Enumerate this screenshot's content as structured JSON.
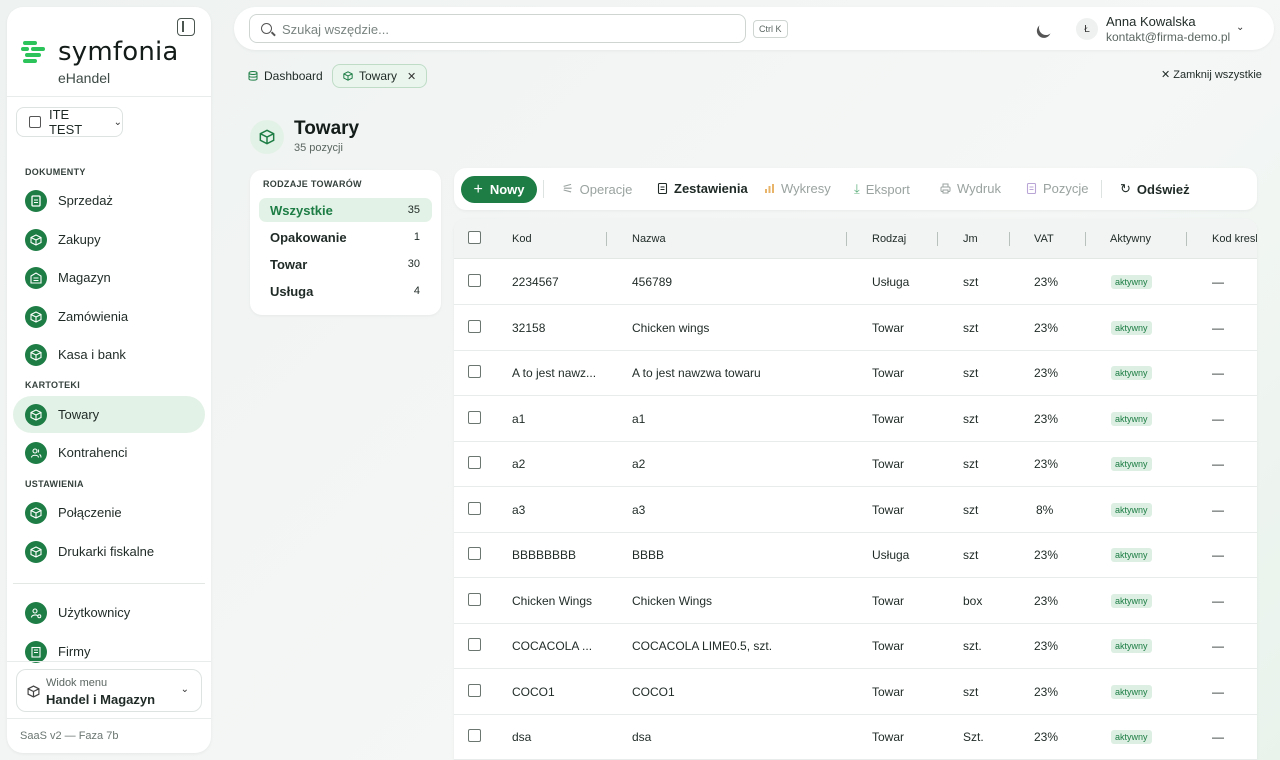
{
  "sidebar": {
    "logo_text": "symfonia",
    "logo_sub": "eHandel",
    "company": "ITE TEST",
    "sections": {
      "dokumenty": "DOKUMENTY",
      "kartoteki": "KARTOTEKI",
      "ustawienia": "USTAWIENIA"
    },
    "items": {
      "sprzedaz": "Sprzedaż",
      "zakupy": "Zakupy",
      "magazyn": "Magazyn",
      "zamowienia": "Zamówienia",
      "kasa": "Kasa i bank",
      "towary": "Towary",
      "kontrahenci": "Kontrahenci",
      "polaczenie": "Połączenie",
      "drukarki": "Drukarki fiskalne",
      "uzytkownicy": "Użytkownicy",
      "firmy": "Firmy"
    },
    "view_menu": {
      "label": "Widok menu",
      "value": "Handel i Magazyn"
    },
    "footer": "SaaS v2 — Faza 7b",
    "accent_color": "#1d7d45"
  },
  "header": {
    "search_placeholder": "Szukaj wszędzie...",
    "shortcut": "Ctrl K",
    "user": {
      "initial": "Ł",
      "name": "Anna Kowalska",
      "email": "kontakt@firma-demo.pl"
    }
  },
  "tabs": {
    "dashboard": "Dashboard",
    "towary": "Towary",
    "close_all": "Zamknij wszystkie"
  },
  "page": {
    "title": "Towary",
    "subtitle": "35 pozycji"
  },
  "categories": {
    "header": "RODZAJE TOWARÓW",
    "items": [
      {
        "label": "Wszystkie",
        "count": "35"
      },
      {
        "label": "Opakowanie",
        "count": "1"
      },
      {
        "label": "Towar",
        "count": "30"
      },
      {
        "label": "Usługa",
        "count": "4"
      }
    ]
  },
  "toolbar": {
    "new": "Nowy",
    "operacje": "Operacje",
    "zestawienia": "Zestawienia",
    "wykresy": "Wykresy",
    "eksport": "Eksport",
    "wydruk": "Wydruk",
    "pozycje": "Pozycje",
    "odswiez": "Odśwież"
  },
  "table": {
    "columns": [
      "Kod",
      "Nazwa",
      "Rodzaj",
      "Jm",
      "VAT",
      "Aktywny",
      "Kod kresk"
    ],
    "rows": [
      [
        "2234567",
        "456789",
        "Usługa",
        "szt",
        "23%",
        "aktywny",
        "—"
      ],
      [
        "32158",
        "Chicken wings",
        "Towar",
        "szt",
        "23%",
        "aktywny",
        "—"
      ],
      [
        "A to jest nawz...",
        "A to jest nawzwa towaru",
        "Towar",
        "szt",
        "23%",
        "aktywny",
        "—"
      ],
      [
        "a1",
        "a1",
        "Towar",
        "szt",
        "23%",
        "aktywny",
        "—"
      ],
      [
        "a2",
        "a2",
        "Towar",
        "szt",
        "23%",
        "aktywny",
        "—"
      ],
      [
        "a3",
        "a3",
        "Towar",
        "szt",
        "8%",
        "aktywny",
        "—"
      ],
      [
        "BBBBBBBB",
        "BBBB",
        "Usługa",
        "szt",
        "23%",
        "aktywny",
        "—"
      ],
      [
        "Chicken Wings",
        "Chicken Wings",
        "Towar",
        "box",
        "23%",
        "aktywny",
        "—"
      ],
      [
        "COCACOLA ...",
        "COCACOLA LIME0.5, szt.",
        "Towar",
        "szt.",
        "23%",
        "aktywny",
        "—"
      ],
      [
        "COCO1",
        "COCO1",
        "Towar",
        "szt",
        "23%",
        "aktywny",
        "—"
      ],
      [
        "dsa",
        "dsa",
        "Towar",
        "Szt.",
        "23%",
        "aktywny",
        "—"
      ]
    ]
  }
}
